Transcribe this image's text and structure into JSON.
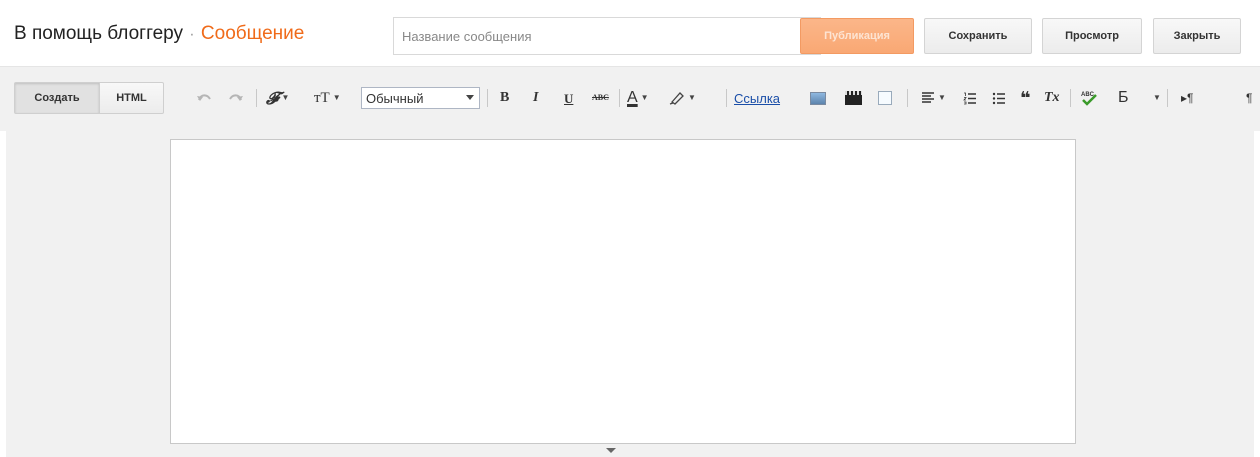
{
  "header": {
    "blog_title": "В помощь блоггеру",
    "separator": "·",
    "section": "Сообщение",
    "title_placeholder": "Название сообщения",
    "buttons": {
      "publish": "Публикация",
      "save": "Сохранить",
      "preview": "Просмотр",
      "close": "Закрыть"
    }
  },
  "toolbar": {
    "mode_create": "Создать",
    "mode_html": "HTML",
    "font_icon": "𝓕",
    "font_size_icon": "тT",
    "format_value": "Обычный",
    "bold": "B",
    "italic": "I",
    "underline": "U",
    "strikethrough": "ABC",
    "text_color": "A",
    "link_label": "Ссылка",
    "quote_icon": "❝",
    "clear_format": "Tx",
    "input_language": "Б",
    "ltr": "▸¶",
    "rtl": "¶"
  },
  "colors": {
    "accent": "#f06b1a",
    "link": "#1a4ea8",
    "toolbar_bg": "#f1f1f1"
  }
}
